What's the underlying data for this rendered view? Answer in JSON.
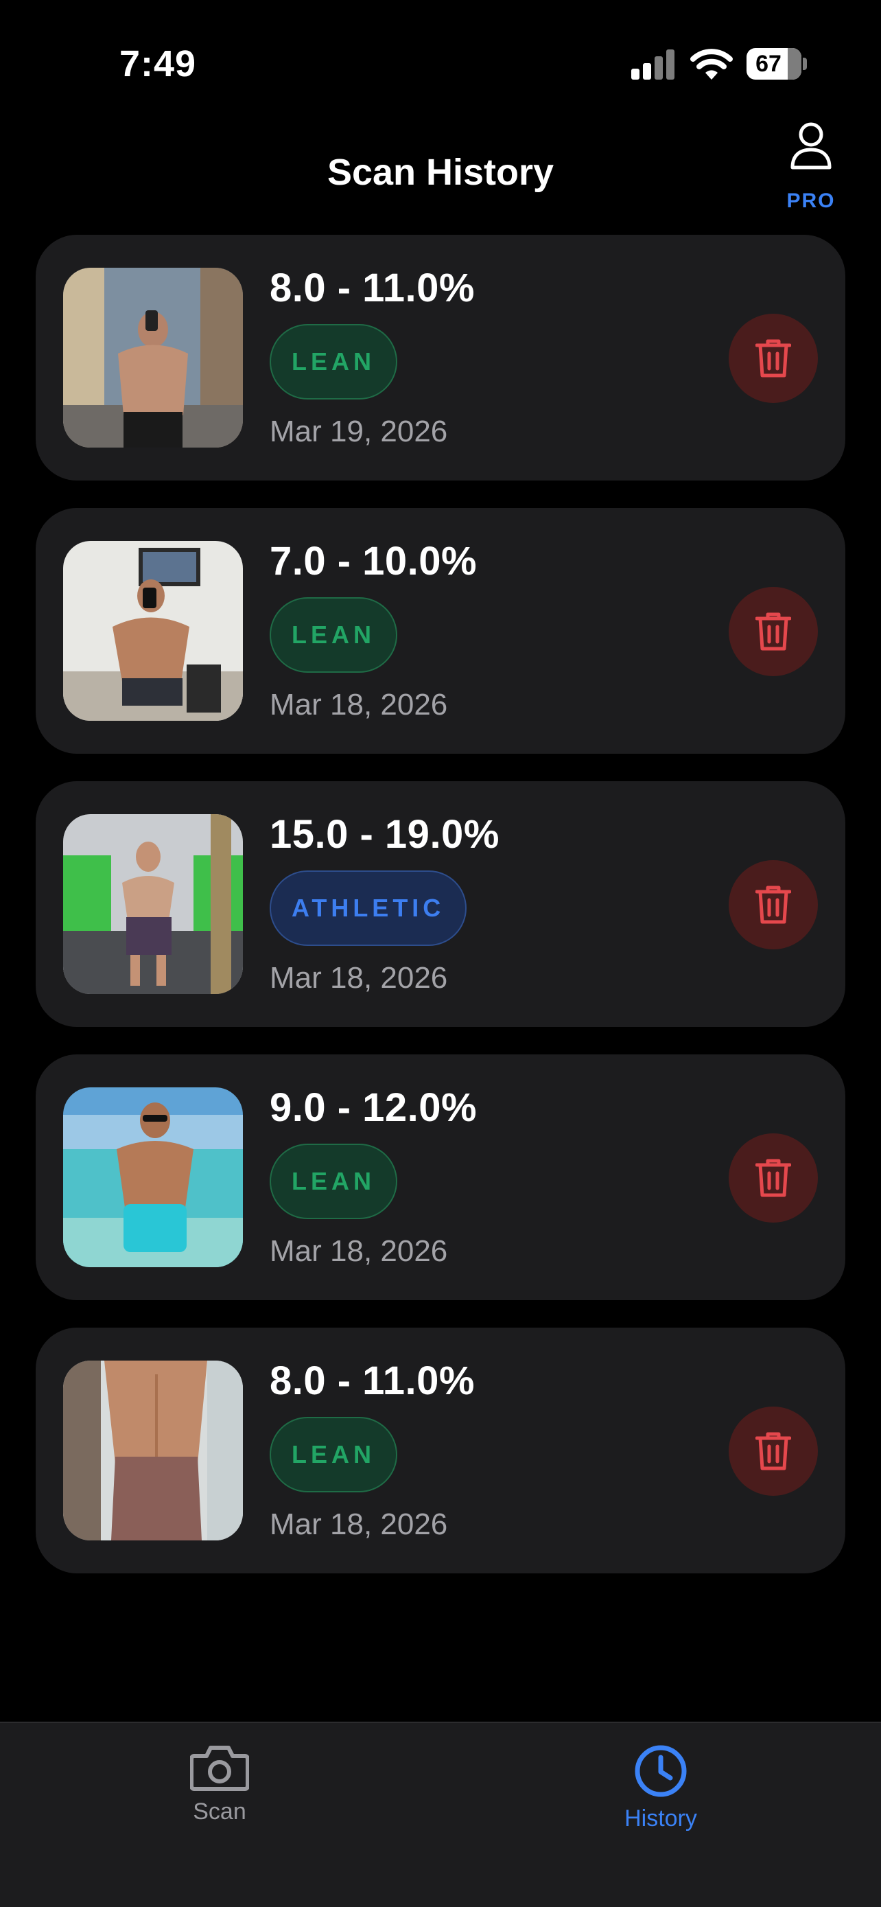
{
  "status_bar": {
    "time": "7:49",
    "battery": "67"
  },
  "header": {
    "title": "Scan History",
    "pro_label": "PRO"
  },
  "scans": [
    {
      "range": "8.0 - 11.0%",
      "category": "LEAN",
      "date": "Mar 19, 2026"
    },
    {
      "range": "7.0 - 10.0%",
      "category": "LEAN",
      "date": "Mar 18, 2026"
    },
    {
      "range": "15.0 - 19.0%",
      "category": "ATHLETIC",
      "date": "Mar 18, 2026"
    },
    {
      "range": "9.0 - 12.0%",
      "category": "LEAN",
      "date": "Mar 18, 2026"
    },
    {
      "range": "8.0 - 11.0%",
      "category": "LEAN",
      "date": "Mar 18, 2026"
    }
  ],
  "tab_bar": {
    "scan_label": "Scan",
    "history_label": "History"
  },
  "colors": {
    "accent": "#3b82f6",
    "lean_text": "#22a565",
    "athletic_text": "#3d7ef0",
    "delete_icon": "#e5484d",
    "card_bg": "#1c1c1e"
  }
}
